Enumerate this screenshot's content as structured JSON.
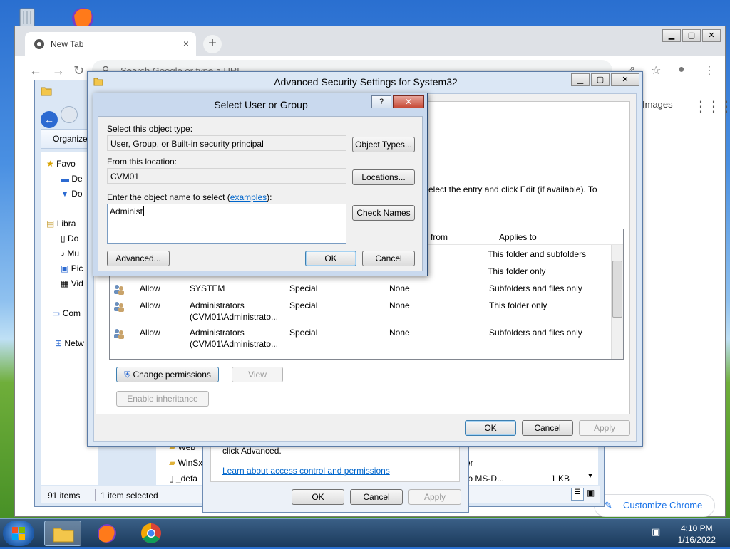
{
  "colors": {
    "accent": "#1a73e8",
    "link": "#0066cc"
  },
  "chrome": {
    "tab_title": "New Tab",
    "tab_close": "×",
    "new_tab": "+",
    "omnibox_placeholder": "Search Google or type a URL",
    "images_link": "Images",
    "customize_label": "Customize Chrome"
  },
  "explorer": {
    "organize": "Organize",
    "sidebar": [
      "Favo",
      "De",
      "Do",
      "Libra",
      "Do",
      "Mu",
      "Pic",
      "Vid",
      "Com",
      "Netw"
    ],
    "files": [
      {
        "name": "Web",
        "type": "",
        "size": ""
      },
      {
        "name": "WinSx",
        "type": "er",
        "size": ""
      },
      {
        "name": "_defa",
        "type": "to MS-D...",
        "size": "1 KB"
      }
    ],
    "status_count": "91 items",
    "status_selected": "1 item selected"
  },
  "permissions_dialog": {
    "text": "click Advanced.",
    "link": "Learn about access control and permissions",
    "ok": "OK",
    "cancel": "Cancel",
    "apply": "Apply"
  },
  "advanced_security": {
    "title": "Advanced Security Settings for System32",
    "instruction": "elect the entry and click Edit (if available). To",
    "columns": [
      "from",
      "Applies to"
    ],
    "rows": [
      {
        "type": "",
        "name": "",
        "name2": "",
        "permission": "",
        "inherited": "",
        "applies": "This folder and subfolders"
      },
      {
        "type": "",
        "name": "",
        "name2": "",
        "permission": "",
        "inherited": "",
        "applies": "This folder only"
      },
      {
        "type": "Allow",
        "name": "SYSTEM",
        "name2": "",
        "permission": "Special",
        "inherited": "None",
        "applies": "Subfolders and files only"
      },
      {
        "type": "Allow",
        "name": "Administrators",
        "name2": "(CVM01\\Administrato...",
        "permission": "Special",
        "inherited": "None",
        "applies": "This folder only"
      },
      {
        "type": "Allow",
        "name": "Administrators",
        "name2": "(CVM01\\Administrato...",
        "permission": "Special",
        "inherited": "None",
        "applies": "Subfolders and files only"
      }
    ],
    "change_permissions": "Change permissions",
    "view": "View",
    "enable_inheritance": "Enable inheritance",
    "ok": "OK",
    "cancel": "Cancel",
    "apply": "Apply"
  },
  "select_user": {
    "title": "Select User or Group",
    "help": "?",
    "object_type_label": "Select this object type:",
    "object_type_value": "User, Group, or Built-in security principal",
    "object_types_button": "Object Types...",
    "location_label": "From this location:",
    "location_value": "CVM01",
    "locations_button": "Locations...",
    "enter_label": "Enter the object name to select (",
    "examples_link": "examples",
    "enter_label_end": "):",
    "name_value": "Administ",
    "check_names_button": "Check Names",
    "advanced_button": "Advanced...",
    "ok": "OK",
    "cancel": "Cancel"
  },
  "taskbar": {
    "time": "4:10 PM",
    "date": "1/16/2022"
  }
}
